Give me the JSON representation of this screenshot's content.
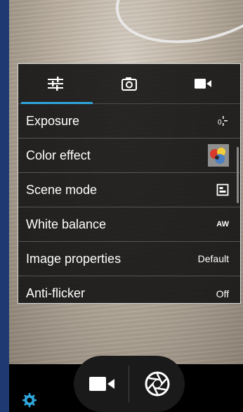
{
  "tabs": [
    {
      "icon": "sliders-icon",
      "active": true
    },
    {
      "icon": "camera-icon",
      "active": false
    },
    {
      "icon": "video-icon",
      "active": false
    }
  ],
  "settings": {
    "rows": [
      {
        "label": "Exposure",
        "icon": "exposure-icon"
      },
      {
        "label": "Color effect",
        "icon": "color-effect-thumbnail"
      },
      {
        "label": "Scene mode",
        "icon": "scene-mode-icon"
      },
      {
        "label": "White balance",
        "icon": "white-balance-auto-icon",
        "badge": "AW"
      },
      {
        "label": "Image properties",
        "value": "Default"
      },
      {
        "label": "Anti-flicker",
        "value": "Off"
      }
    ]
  },
  "colors": {
    "accent": "#2fa5da",
    "gear": "#2fa5da"
  }
}
